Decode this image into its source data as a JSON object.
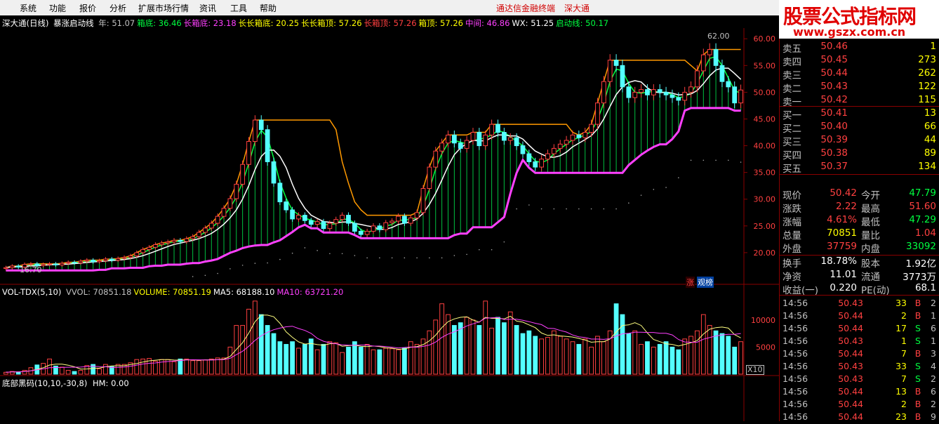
{
  "menu": {
    "items": [
      "系统",
      "功能",
      "报价",
      "分析",
      "扩展市场行情",
      "资讯",
      "工具",
      "帮助"
    ],
    "terminal_link": "通达信金融终端",
    "stock_link": "深大通"
  },
  "logo": {
    "title": "股票公式指标网",
    "url": "www.gszx.com.cn"
  },
  "main_indicator": {
    "stock": "深大通(日线)",
    "name": "暴涨启动线",
    "fields": [
      {
        "label": "年: 51.07",
        "color": "#c0c0c0"
      },
      {
        "label": "箱底: 36.46",
        "color": "#00ff40"
      },
      {
        "label": "长箱底: 23.18",
        "color": "#ff40ff"
      },
      {
        "label": "长长箱底: 20.25",
        "color": "#ffff00"
      },
      {
        "label": "长长箱顶: 57.26",
        "color": "#ffff00"
      },
      {
        "label": "长箱顶: 57.26",
        "color": "#ff4040"
      },
      {
        "label": "箱顶: 57.26",
        "color": "#ffff00"
      },
      {
        "label": "中间: 46.86",
        "color": "#ff40ff"
      },
      {
        "label": "WX: 51.25",
        "color": "#ffffff"
      },
      {
        "label": "启动线: 50.17",
        "color": "#00ff40"
      }
    ],
    "high_label": "62.00",
    "low_label": "16.70",
    "y_ticks": [
      "60.00",
      "55.00",
      "50.00",
      "45.00",
      "40.00",
      "35.00",
      "30.00",
      "25.00",
      "20.00"
    ],
    "tag_zhang": "涨",
    "tag_guan": "观榜"
  },
  "chart_data": {
    "type": "candlestick",
    "title": "深大通(日线) 暴涨启动线",
    "ylim": [
      15,
      62
    ],
    "closes": [
      17.2,
      17.5,
      17.3,
      17.8,
      17.9,
      17.6,
      17.8,
      17.9,
      17.7,
      18.0,
      18.2,
      18.1,
      18.4,
      18.6,
      18.3,
      18.5,
      18.8,
      18.6,
      18.9,
      19.1,
      19.4,
      20.0,
      20.6,
      21.0,
      21.5,
      21.8,
      22.0,
      22.3,
      22.1,
      22.6,
      23.0,
      23.8,
      24.6,
      25.5,
      26.8,
      28.3,
      30.1,
      32.8,
      36.5,
      40.8,
      44.8,
      43.0,
      37.0,
      33.0,
      29.5,
      28.0,
      26.3,
      27.0,
      26.0,
      25.3,
      25.8,
      24.5,
      25.5,
      26.2,
      27.0,
      25.5,
      24.0,
      23.4,
      24.0,
      25.0,
      24.3,
      25.6,
      25.9,
      26.8,
      25.5,
      26.5,
      27.5,
      32.0,
      36.0,
      39.0,
      40.5,
      42.0,
      40.5,
      39.5,
      41.0,
      42.5,
      40.0,
      42.0,
      44.0,
      42.5,
      41.0,
      41.5,
      40.0,
      38.5,
      37.0,
      36.0,
      37.5,
      38.5,
      39.5,
      40.3,
      41.0,
      42.0,
      41.5,
      42.5,
      44.0,
      48.0,
      52.0,
      56.0,
      55.0,
      51.0,
      49.0,
      50.0,
      50.5,
      49.5,
      50.5,
      50.0,
      49.5,
      49.0,
      48.5,
      50.0,
      51.0,
      54.0,
      57.0,
      58.0,
      55.0,
      52.0,
      51.0,
      48.0,
      50.42
    ],
    "volume_ylim": [
      0,
      14000
    ],
    "volume_ticks": [
      "10000",
      "5000"
    ],
    "volumes": [
      350,
      500,
      380,
      700,
      1200,
      1700,
      2000,
      2800,
      1500,
      1300,
      700,
      500,
      700,
      1600,
      1800,
      1000,
      1800,
      1400,
      1800,
      1800,
      2100,
      2700,
      2800,
      2900,
      2400,
      2700,
      2700,
      2300,
      2800,
      2800,
      2500,
      2500,
      2600,
      2800,
      3000,
      3000,
      5000,
      9000,
      9000,
      12000,
      13500,
      11000,
      9000,
      7500,
      6000,
      5500,
      6000,
      4800,
      5500,
      6500,
      4500,
      5500,
      6000,
      5800,
      4000,
      5000,
      6000,
      5000,
      5500,
      4500,
      4500,
      4800,
      4700,
      4500,
      4800,
      6000,
      5500,
      6500,
      8000,
      10000,
      13000,
      11000,
      9000,
      9500,
      10500,
      10000,
      9000,
      13500,
      8500,
      10500,
      9500,
      11500,
      9000,
      7500,
      8000,
      7000,
      6500,
      6800,
      8000,
      7000,
      6500,
      6000,
      5500,
      6500,
      5000,
      7000,
      6000,
      8000,
      13000,
      11000,
      7500,
      8000,
      5500,
      6000,
      5000,
      5500,
      6000,
      5000,
      4500,
      6500,
      7000,
      8000,
      11000,
      9000,
      8000,
      7500,
      7000,
      5000,
      6000
    ],
    "vol_indicator": {
      "name": "VOL-TDX(5,10)",
      "fields": [
        {
          "label": "VVOL: 70851.18",
          "color": "#c0c0c0"
        },
        {
          "label": "VOLUME: 70851.19",
          "color": "#ffff00"
        },
        {
          "label": "MA5: 68188.10",
          "color": "#ffffff"
        },
        {
          "label": "MA10: 63721.20",
          "color": "#ff40ff"
        }
      ]
    },
    "hm_indicator": {
      "name": "底部黑码(10,10,-30,8)",
      "value": "HM: 0.00"
    },
    "x10_label": "X10"
  },
  "quote": {
    "order_book": [
      {
        "label": "卖五",
        "price": "50.46",
        "vol": "1"
      },
      {
        "label": "卖四",
        "price": "50.45",
        "vol": "273"
      },
      {
        "label": "卖三",
        "price": "50.44",
        "vol": "262"
      },
      {
        "label": "卖二",
        "price": "50.43",
        "vol": "122"
      },
      {
        "label": "卖一",
        "price": "50.42",
        "vol": "115"
      },
      {
        "label": "买一",
        "price": "50.41",
        "vol": "13"
      },
      {
        "label": "买二",
        "price": "50.40",
        "vol": "66"
      },
      {
        "label": "买三",
        "price": "50.39",
        "vol": "44"
      },
      {
        "label": "买四",
        "price": "50.38",
        "vol": "89"
      },
      {
        "label": "买五",
        "price": "50.37",
        "vol": "134"
      }
    ],
    "stats": [
      {
        "l1": "现价",
        "v1": "50.42",
        "c1": "#ff4040",
        "l2": "今开",
        "v2": "47.79",
        "c2": "#00ff40"
      },
      {
        "l1": "涨跌",
        "v1": "2.22",
        "c1": "#ff4040",
        "l2": "最高",
        "v2": "51.60",
        "c2": "#ff4040"
      },
      {
        "l1": "涨幅",
        "v1": "4.61%",
        "c1": "#ff4040",
        "l2": "最低",
        "v2": "47.29",
        "c2": "#00ff40"
      },
      {
        "l1": "总量",
        "v1": "70851",
        "c1": "#ffff00",
        "l2": "量比",
        "v2": "1.04",
        "c2": "#ff4040"
      },
      {
        "l1": "外盘",
        "v1": "37759",
        "c1": "#ff4040",
        "l2": "内盘",
        "v2": "33092",
        "c2": "#00ff40"
      }
    ],
    "stats2": [
      {
        "l1": "换手",
        "v1": "18.78%",
        "l2": "股本",
        "v2": "1.92亿"
      },
      {
        "l1": "净资",
        "v1": "11.01",
        "l2": "流通",
        "v2": "3773万"
      },
      {
        "l1": "收益(一)",
        "v1": "0.220",
        "l2": "PE(动)",
        "v2": "68.1"
      }
    ],
    "ticks": [
      {
        "time": "14:56",
        "price": "50.43",
        "vol": "33",
        "bs": "B",
        "n": "2"
      },
      {
        "time": "14:56",
        "price": "50.44",
        "vol": "2",
        "bs": "B",
        "n": "1"
      },
      {
        "time": "14:56",
        "price": "50.44",
        "vol": "17",
        "bs": "S",
        "n": "6"
      },
      {
        "time": "14:56",
        "price": "50.43",
        "vol": "1",
        "bs": "S",
        "n": "1"
      },
      {
        "time": "14:56",
        "price": "50.44",
        "vol": "7",
        "bs": "B",
        "n": "3"
      },
      {
        "time": "14:56",
        "price": "50.43",
        "vol": "33",
        "bs": "S",
        "n": "4"
      },
      {
        "time": "14:56",
        "price": "50.43",
        "vol": "7",
        "bs": "S",
        "n": "2"
      },
      {
        "time": "14:56",
        "price": "50.44",
        "vol": "13",
        "bs": "B",
        "n": "6"
      },
      {
        "time": "14:56",
        "price": "50.44",
        "vol": "2",
        "bs": "B",
        "n": "2"
      },
      {
        "time": "14:56",
        "price": "50.44",
        "vol": "23",
        "bs": "B",
        "n": "9"
      }
    ]
  },
  "colors": {
    "up": "#ff4040",
    "down": "#54ffff",
    "box": "#ff9900",
    "mid": "#ff40ff",
    "qd": "#00ff40",
    "wx": "#ffffff"
  }
}
